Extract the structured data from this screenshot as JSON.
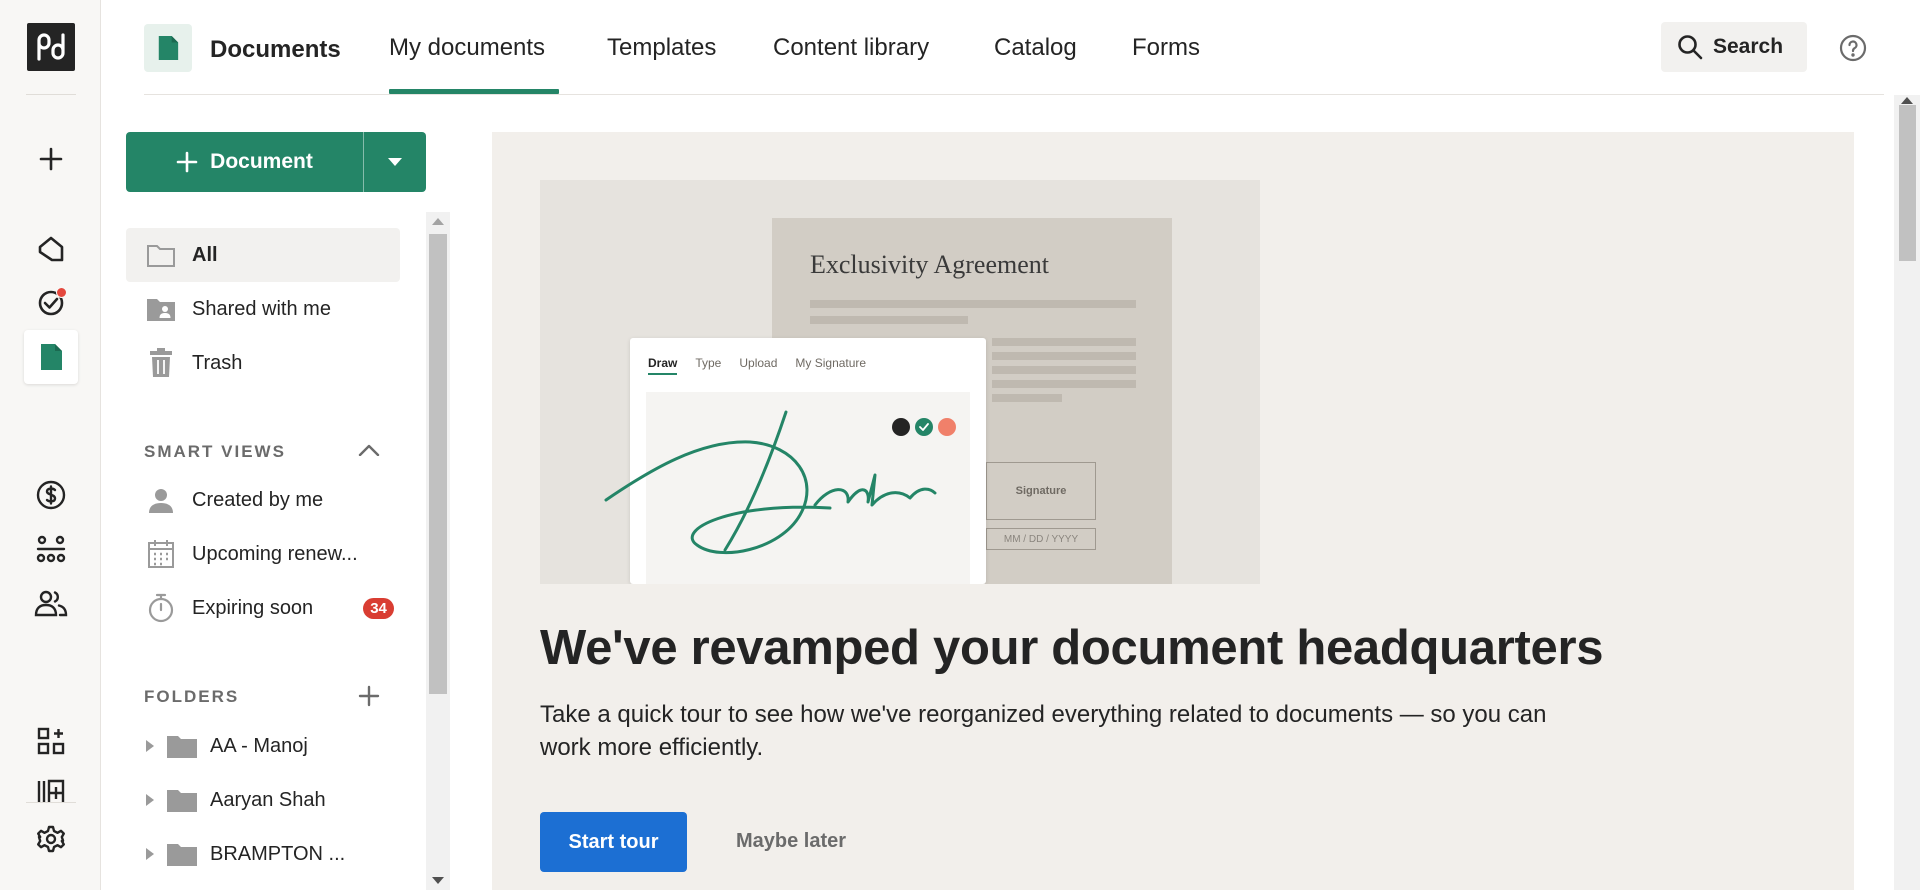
{
  "header": {
    "app_title": "Documents",
    "tabs": [
      {
        "label": "My documents",
        "active": true
      },
      {
        "label": "Templates"
      },
      {
        "label": "Content library"
      },
      {
        "label": "Catalog"
      },
      {
        "label": "Forms"
      }
    ],
    "search_label": "Search"
  },
  "rail": {
    "icons": [
      "pandadoc-logo",
      "plus-icon",
      "home-icon",
      "tasks-icon",
      "documents-icon",
      "dollar-icon",
      "org-chart-icon",
      "contacts-icon",
      "apps-icon",
      "add-template-icon",
      "settings-icon"
    ]
  },
  "sidebar": {
    "new_document_label": "Document",
    "items": [
      {
        "label": "All",
        "icon": "folder-outline-icon",
        "selected": true
      },
      {
        "label": "Shared with me",
        "icon": "shared-folder-icon"
      },
      {
        "label": "Trash",
        "icon": "trash-icon"
      }
    ],
    "smart_views": {
      "title": "SMART VIEWS",
      "items": [
        {
          "label": "Created by me",
          "icon": "person-icon"
        },
        {
          "label": "Upcoming renew...",
          "icon": "calendar-icon"
        },
        {
          "label": "Expiring soon",
          "icon": "stopwatch-icon",
          "badge": "34"
        }
      ]
    },
    "folders": {
      "title": "FOLDERS",
      "items": [
        {
          "label": "AA - Manoj"
        },
        {
          "label": "Aaryan Shah"
        },
        {
          "label": "BRAMPTON ..."
        }
      ]
    }
  },
  "promo": {
    "illustration": {
      "paper_title": "Exclusivity Agreement",
      "signature_box_label": "Signature",
      "date_placeholder": "MM / DD / YYYY",
      "sign_tabs": [
        "Draw",
        "Type",
        "Upload",
        "My Signature"
      ],
      "swatch_colors": [
        "#242424",
        "#248567",
        "#f0806a"
      ]
    },
    "headline": "We've revamped your document headquarters",
    "description": "Take a quick tour to see how we've reorganized everything related to documents — so you can work more efficiently.",
    "start_tour_label": "Start tour",
    "maybe_later_label": "Maybe later"
  },
  "colors": {
    "accent_green": "#248567",
    "primary_blue": "#1c6fd3",
    "badge_red": "#d93d32",
    "panel_bg": "#f2efeb"
  }
}
